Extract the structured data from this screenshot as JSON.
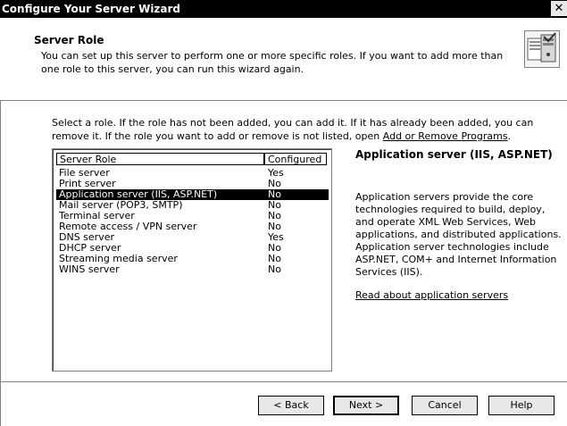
{
  "window": {
    "title": "Configure Your Server Wizard",
    "close_label": "✕"
  },
  "header": {
    "title": "Server Role",
    "description": "You can set up this server to perform one or more specific roles. If you want to add more than one role to this server, you can run this wizard again.",
    "icon": "server-role-icon"
  },
  "instructions": {
    "text": "Select a role. If the role has not been added, you can add it. If it has already been added, you can remove it. If the role you want to add or remove is not listed, open ",
    "link": "Add or Remove Programs",
    "suffix": "."
  },
  "roles": {
    "columns": [
      "Server Role",
      "Configured"
    ],
    "items": [
      {
        "name": "File server",
        "configured": "Yes"
      },
      {
        "name": "Print server",
        "configured": "No"
      },
      {
        "name": "Application server (IIS, ASP.NET)",
        "configured": "No",
        "selected": true
      },
      {
        "name": "Mail server (POP3, SMTP)",
        "configured": "No"
      },
      {
        "name": "Terminal server",
        "configured": "No"
      },
      {
        "name": "Remote access / VPN server",
        "configured": "No"
      },
      {
        "name": "DNS server",
        "configured": "Yes"
      },
      {
        "name": "DHCP server",
        "configured": "No"
      },
      {
        "name": "Streaming media server",
        "configured": "No"
      },
      {
        "name": "WINS server",
        "configured": "No"
      }
    ]
  },
  "detail": {
    "title": "Application server (IIS, ASP.NET)",
    "description": "Application servers provide the core technologies required to build, deploy, and operate XML Web Services, Web applications, and distributed applications. Application server technologies include ASP.NET, COM+ and Internet Information Services (IIS).",
    "link": "Read about application servers"
  },
  "buttons": {
    "back": "< Back",
    "next": "Next >",
    "cancel": "Cancel",
    "help": "Help"
  }
}
